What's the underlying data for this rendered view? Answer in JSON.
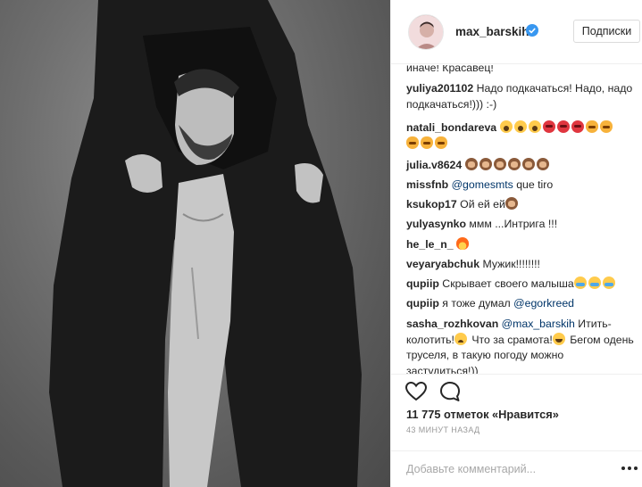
{
  "post": {
    "username": "max_barskih",
    "follow_label": "Подписки",
    "likes_count": "11 775",
    "likes_text": " отметок «Нравится»",
    "timestamp": "43 минут назад",
    "comment_placeholder": "Добавьте комментарий..."
  },
  "icons": {
    "verified": "verified-badge-icon",
    "like": "heart-icon",
    "comment": "speech-bubble-icon",
    "more": "ellipsis-icon"
  },
  "colors": {
    "verified_blue": "#3897f0",
    "mention_blue": "#003569",
    "text": "#262626",
    "muted": "#999999",
    "border": "#efefef"
  },
  "comments": [
    {
      "text": "иначе! Красавец!"
    },
    {
      "user": "yuliya201102",
      "text": " Надо подкачаться! Надо, надо подкачаться!))) :-)"
    },
    {
      "user": "natali_bondareva",
      "text": " "
    },
    {
      "user": "julia.v8624",
      "text": " "
    },
    {
      "user": "missfnb",
      "mention": "@gomesmts",
      "text": " que tiro"
    },
    {
      "user": "ksukop17",
      "text": " Ой ей ей"
    },
    {
      "user": "yulyasynko",
      "text": " ммм ...Интрига !!!"
    },
    {
      "user": "he_le_n_",
      "text": " "
    },
    {
      "user": "veyaryabchuk",
      "text": " Мужик!!!!!!!!"
    },
    {
      "user": "qupiip",
      "text": " Скрывает своего малыша"
    },
    {
      "user": "qupiip",
      "text": " я тоже думал ",
      "mention": "@egorkreed"
    },
    {
      "user": "sasha_rozhkovan",
      "mention": "@max_barskih",
      "text_a": " Итить-колотить!",
      "text_b": " Что за срамота!",
      "text_c": " Бегом одень труселя, в такую погоду можно застудиться!))"
    }
  ]
}
